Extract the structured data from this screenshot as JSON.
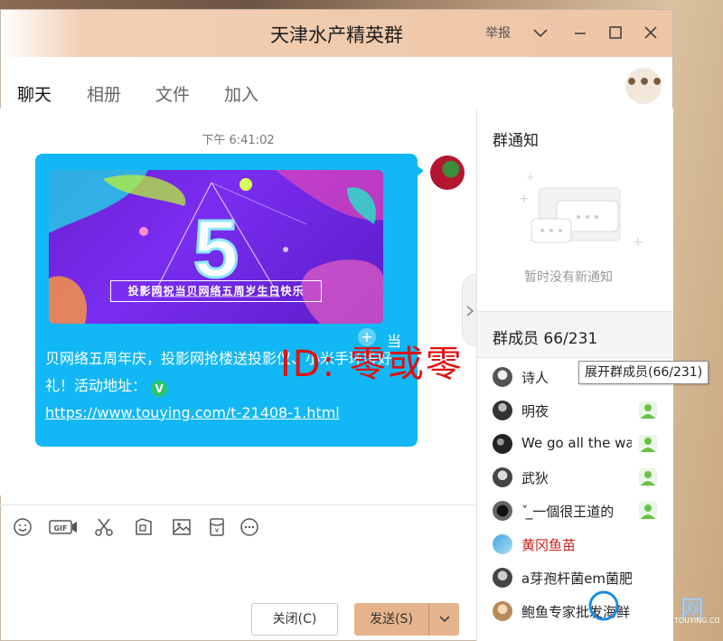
{
  "window": {
    "title": "天津水产精英群",
    "report_label": "举报"
  },
  "tabs": [
    {
      "label": "聊天",
      "active": true
    },
    {
      "label": "相册",
      "active": false
    },
    {
      "label": "文件",
      "active": false
    },
    {
      "label": "加入",
      "active": false
    }
  ],
  "chat": {
    "timestamp": "下午 6:41:02",
    "banner": {
      "digit": "5",
      "caption": "投影网祝当贝网络五周岁生日快乐"
    },
    "stray_char": "当",
    "message_text": "贝网络五周年庆，投影网抢楼送投影仪、小米手环等好礼！活动地址：",
    "verified_badge": "V",
    "message_link": "https://www.touying.com/t-21408-1.html",
    "watermark": "ID: 零或零"
  },
  "toolbar_icons": [
    "emoji-icon",
    "gif-icon",
    "scissors-icon",
    "screenshot-icon",
    "image-icon",
    "red-packet-icon",
    "more-icon"
  ],
  "buttons": {
    "close": "关闭(C)",
    "send": "发送(S)"
  },
  "notice": {
    "title": "群通知",
    "empty_text": "暂时没有新通知"
  },
  "members": {
    "title": "群成员 66/231",
    "tooltip": "展开群成员(66/231)",
    "list": [
      {
        "name": "诗人",
        "admin": false,
        "highlight": false
      },
      {
        "name": "明夜",
        "admin": true,
        "highlight": false
      },
      {
        "name": "We go all the way",
        "admin": true,
        "highlight": false
      },
      {
        "name": "武狄",
        "admin": true,
        "highlight": false
      },
      {
        "name": "ˇ ̲̲一個很王道的",
        "admin": true,
        "highlight": false
      },
      {
        "name": "黄冈鱼苗",
        "admin": false,
        "highlight": true
      },
      {
        "name": "a芽孢杆菌em菌肥水",
        "admin": false,
        "highlight": false
      },
      {
        "name": "鲍鱼专家批发海鲜",
        "admin": false,
        "highlight": false
      }
    ]
  },
  "colors": {
    "bubble": "#12b7f5",
    "titlebar": "#eec5a5",
    "send_button": "#e6b48c",
    "highlight_name": "#c8201a",
    "watermark": "#e01010"
  },
  "corner_logo": {
    "text": "网",
    "subtext": "TOUYING.COM"
  }
}
